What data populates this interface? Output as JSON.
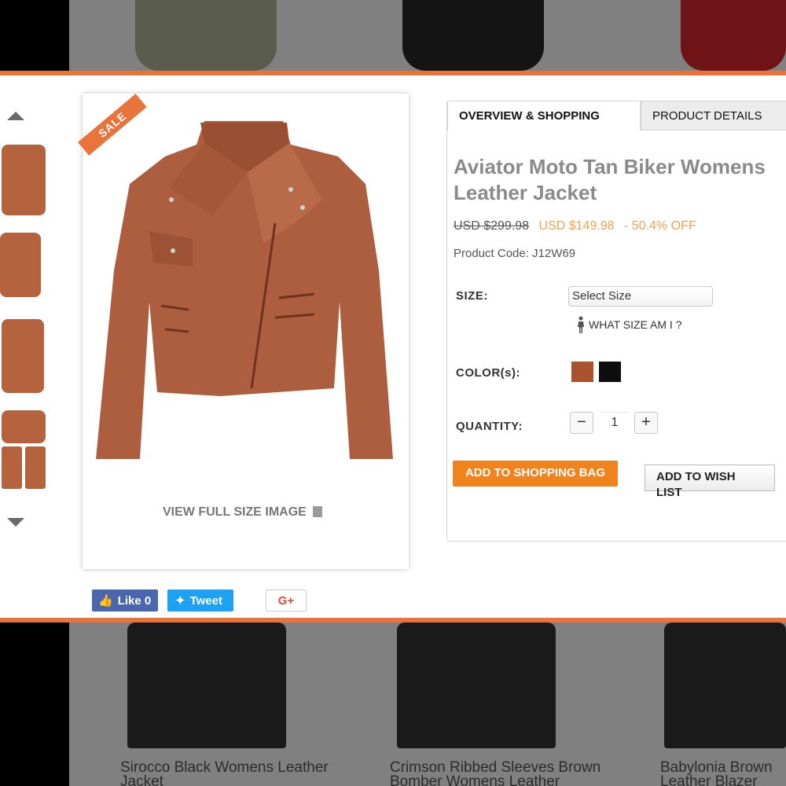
{
  "product": {
    "title": "Aviator Moto Tan Biker Womens Leather Jacket",
    "old_price": "USD $299.98",
    "new_price": "USD $149.98",
    "discount": "-  50.4%  OFF",
    "code": "Product Code: J12W69",
    "sale_badge": "SALE"
  },
  "tabs": {
    "active": "OVERVIEW & SHOPPING",
    "inactive": "PRODUCT DETAILS"
  },
  "options": {
    "size_label": "SIZE:",
    "size_value": "Select Size",
    "size_help": "WHAT SIZE AM I ?",
    "color_label": "COLOR(s):",
    "colors": [
      "#a9522f",
      "#0d0d0d"
    ],
    "quantity_label": "QUANTITY:",
    "quantity": "1",
    "minus": "−",
    "plus": "+"
  },
  "actions": {
    "add_to_bag": "ADD TO SHOPPING BAG",
    "add_to_wishlist": "ADD TO WISH LIST",
    "view_full": "VIEW FULL SIZE IMAGE"
  },
  "social": {
    "like": "Like 0",
    "tweet": "Tweet",
    "gplus": "G+"
  },
  "background_captions": [
    "Sirocco Black Womens Leather Jacket",
    "Crimson Ribbed Sleeves Brown Bomber Womens Leather",
    "Babylonia Brown Leather Blazer"
  ],
  "colors": {
    "accent": "#e8743b",
    "price": "#f2a052",
    "cart_button": "#f0831e"
  }
}
